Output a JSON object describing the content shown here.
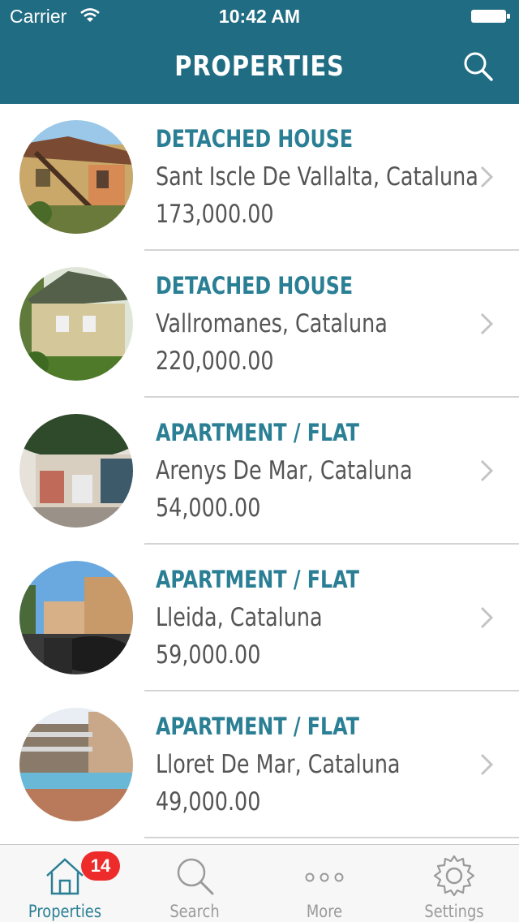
{
  "status_bar": {
    "carrier": "Carrier",
    "time": "10:42 AM"
  },
  "nav": {
    "title": "PROPERTIES",
    "search_icon": "search-icon"
  },
  "accent_color": "#206c83",
  "listings": [
    {
      "type": "DETACHED HOUSE",
      "location": "Sant Iscle De Vallalta, Cataluna",
      "price": "173,000.00"
    },
    {
      "type": "DETACHED HOUSE",
      "location": "Vallromanes, Cataluna",
      "price": "220,000.00"
    },
    {
      "type": "APARTMENT / FLAT",
      "location": "Arenys De Mar, Cataluna",
      "price": "54,000.00"
    },
    {
      "type": "APARTMENT / FLAT",
      "location": "Lleida, Cataluna",
      "price": "59,000.00"
    },
    {
      "type": "APARTMENT / FLAT",
      "location": "Lloret De Mar, Cataluna",
      "price": "49,000.00"
    }
  ],
  "tab_bar": {
    "tabs": [
      {
        "label": "Properties",
        "icon": "home-icon",
        "active": true,
        "badge": "14"
      },
      {
        "label": "Search",
        "icon": "search-icon"
      },
      {
        "label": "More",
        "icon": "more-icon"
      },
      {
        "label": "Settings",
        "icon": "gear-icon"
      }
    ]
  }
}
